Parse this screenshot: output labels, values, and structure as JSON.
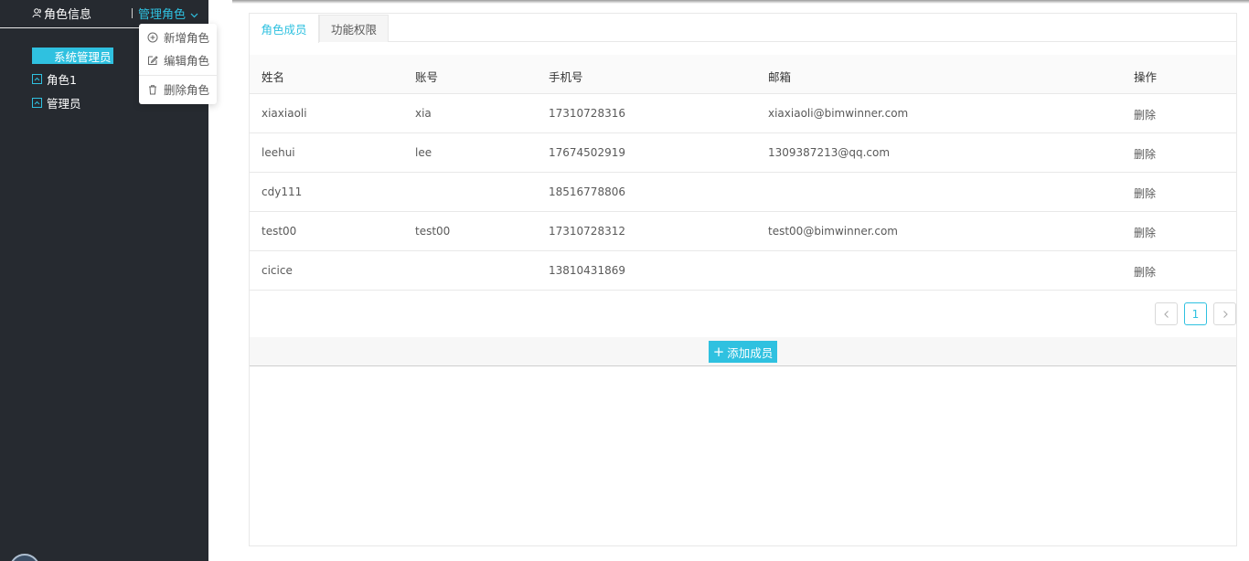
{
  "sidebar": {
    "header_info_label": "角色信息",
    "header_manage_label": "管理角色",
    "tree": [
      {
        "label": "系统管理员",
        "selected": true
      },
      {
        "label": "角色1",
        "selected": false
      },
      {
        "label": "管理员",
        "selected": false
      }
    ]
  },
  "dropdown": {
    "items": [
      {
        "label": "新增角色",
        "icon": "plus-circle-icon"
      },
      {
        "label": "编辑角色",
        "icon": "edit-icon"
      },
      {
        "label": "删除角色",
        "icon": "trash-icon"
      }
    ]
  },
  "tabs": [
    {
      "label": "角色成员",
      "active": true
    },
    {
      "label": "功能权限",
      "active": false
    }
  ],
  "table": {
    "columns": [
      "姓名",
      "账号",
      "手机号",
      "邮箱",
      "操作"
    ],
    "rows": [
      {
        "name": "xiaxiaoli",
        "account": "xia",
        "phone": "17310728316",
        "email": "xiaxiaoli@bimwinner.com",
        "action": "删除"
      },
      {
        "name": "leehui",
        "account": "lee",
        "phone": "17674502919",
        "email": "1309387213@qq.com",
        "action": "删除"
      },
      {
        "name": "cdy111",
        "account": "",
        "phone": "18516778806",
        "email": "",
        "action": "删除"
      },
      {
        "name": "test00",
        "account": "test00",
        "phone": "17310728312",
        "email": "test00@bimwinner.com",
        "action": "删除"
      },
      {
        "name": "cicice",
        "account": "",
        "phone": "13810431869",
        "email": "",
        "action": "删除"
      }
    ]
  },
  "pagination": {
    "current_page": "1"
  },
  "add_member_label": "添加成员",
  "colors": {
    "accent": "#2fc1e0",
    "sidebar_bg": "#262a30"
  }
}
